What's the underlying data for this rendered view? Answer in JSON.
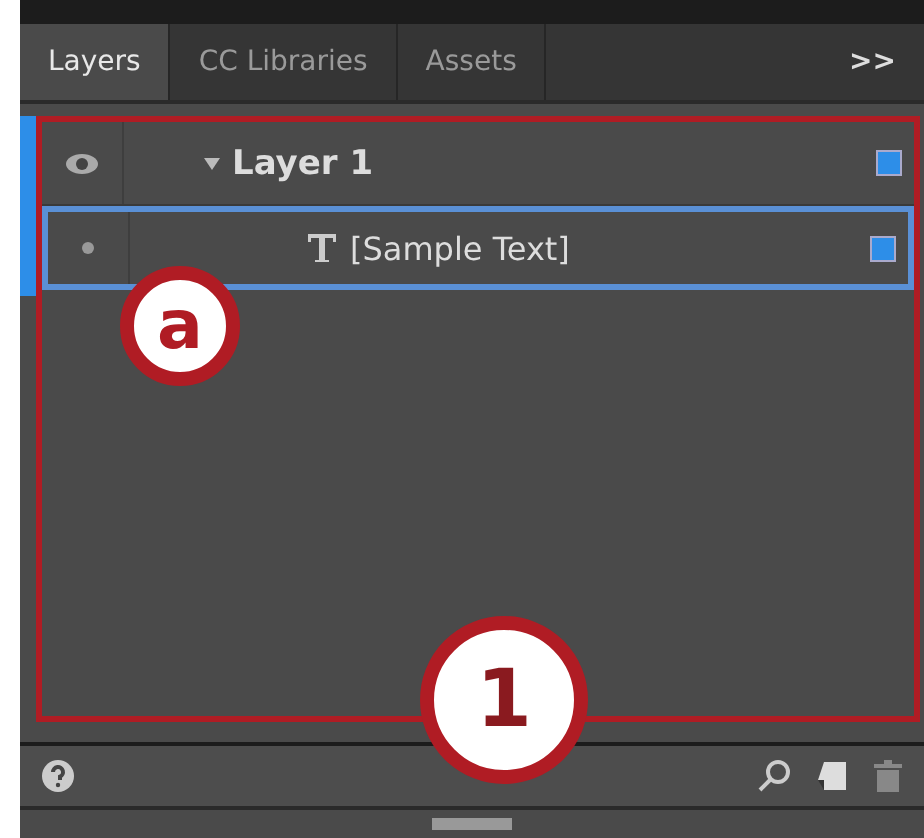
{
  "tabs": [
    {
      "label": "Layers",
      "selected": true
    },
    {
      "label": "CC Libraries",
      "selected": false
    },
    {
      "label": "Assets",
      "selected": false
    }
  ],
  "overflow_button": ">>",
  "layers": [
    {
      "name": "Layer 1",
      "expanded": true,
      "selected": false,
      "children": [
        {
          "name": "[Sample Text]",
          "kind": "text",
          "selected": true
        }
      ]
    }
  ],
  "callouts": [
    "a",
    "1"
  ]
}
